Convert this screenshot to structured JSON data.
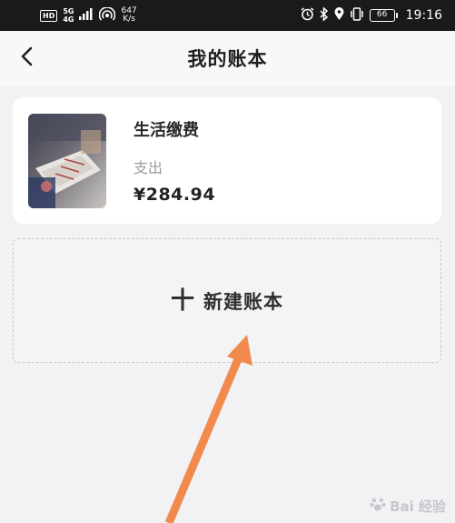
{
  "status_bar": {
    "hd": "HD",
    "signal_top": "5G",
    "signal_bottom": "4G",
    "speed_value": "647",
    "speed_unit": "K/s",
    "battery": "66",
    "time": "19:16",
    "icons": [
      "signal-icon",
      "hotspot-icon",
      "alarm-icon",
      "bluetooth-icon",
      "location-icon",
      "vibrate-icon",
      "battery-icon"
    ]
  },
  "header": {
    "title": "我的账本",
    "back_icon": "chevron-left-icon"
  },
  "books": [
    {
      "name": "生活缴费",
      "type": "支出",
      "amount": "¥284.94"
    }
  ],
  "new_book": {
    "plus": "十",
    "label": "新建账本"
  },
  "watermark": {
    "text": "Bai 经验",
    "icon": "paw-icon"
  },
  "colors": {
    "status_bar_bg": "#1a1a1a",
    "page_bg": "#f2f2f4",
    "card_bg": "#ffffff",
    "arrow": "#f28a4e"
  }
}
